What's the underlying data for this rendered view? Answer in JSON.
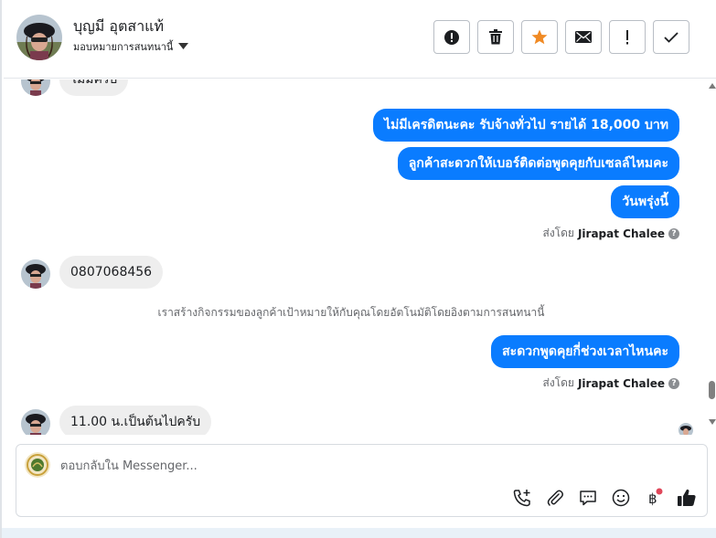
{
  "header": {
    "contact_name": "บุญมี อุตสาแท้",
    "assign_label": "มอบหมายการสนทนานี้",
    "tools": [
      {
        "name": "spam",
        "icon": "exclamation-circle-icon"
      },
      {
        "name": "delete",
        "icon": "trash-icon"
      },
      {
        "name": "star",
        "icon": "star-icon"
      },
      {
        "name": "mark-unread",
        "icon": "envelope-icon"
      },
      {
        "name": "follow-up",
        "icon": "exclamation-icon"
      },
      {
        "name": "done",
        "icon": "check-icon"
      }
    ]
  },
  "messages": {
    "partial_in": "ไม่มีครับ",
    "out_1": "ไม่มีเครดิตนะคะ รับจ้างทั่วไป รายได้ 18,000 บาท",
    "out_2": "ลูกค้าสะดวกให้เบอร์ติดต่อพูดคุยกับเซลล์ไหมคะ",
    "out_3": "วันพรุ่งนี้",
    "sent_by_prefix": "ส่งโดย",
    "sent_by_name": "Jirapat Chalee",
    "in_phone": "0807068456",
    "system_note": "เราสร้างกิจกรรมของลูกค้าเป้าหมายให้กับคุณโดยอัตโนมัติโดยอิงตามการสนทนานี้",
    "out_4": "สะดวกพูดคุยกี่ช่วงเวลาไหนคะ",
    "in_time": "11.00 น.เป็นต้นไปครับ"
  },
  "composer": {
    "placeholder": "ตอบกลับใน Messenger...",
    "icons": [
      "call-add-icon",
      "paperclip-icon",
      "saved-reply-icon",
      "emoji-icon",
      "payment-icon",
      "thumbs-up-icon"
    ]
  },
  "colors": {
    "outgoing_bubble": "#0a7cff",
    "incoming_bubble": "#eeeeee",
    "star": "#f08a24",
    "notification_dot": "#e0475a"
  }
}
